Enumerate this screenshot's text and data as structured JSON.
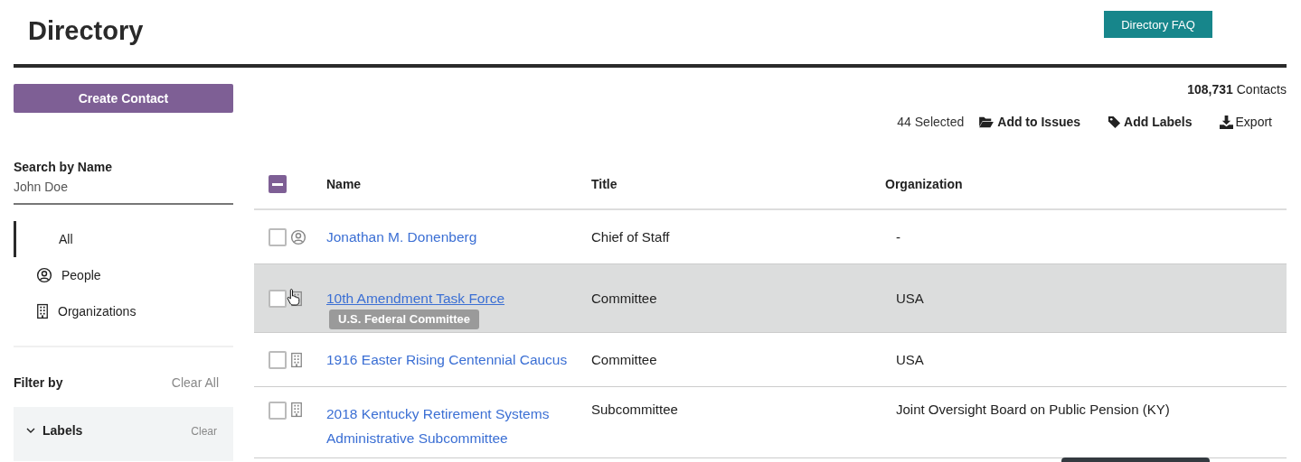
{
  "page": {
    "title": "Directory",
    "faq_button": "Directory FAQ"
  },
  "sidebar": {
    "create_button": "Create Contact",
    "search": {
      "label": "Search by Name",
      "placeholder": "John Doe"
    },
    "nav": [
      {
        "label": "All",
        "kind": "all",
        "selected": true
      },
      {
        "label": "People",
        "kind": "person",
        "selected": false
      },
      {
        "label": "Organizations",
        "kind": "organization",
        "selected": false
      }
    ],
    "filter": {
      "title": "Filter by",
      "clear_all": "Clear All",
      "groups": [
        {
          "label": "Labels",
          "clear": "Clear",
          "expanded": true
        }
      ]
    }
  },
  "summary": {
    "count": "108,731",
    "unit": "Contacts"
  },
  "toolbar": {
    "selected_count": "44 Selected",
    "actions": [
      {
        "label": "Add to Issues",
        "kind": "folder",
        "bold": true
      },
      {
        "label": "Add Labels",
        "kind": "tag",
        "bold": true
      },
      {
        "label": "Export",
        "kind": "download",
        "bold": false
      }
    ]
  },
  "table": {
    "select_all": {
      "indeterminate": true
    },
    "columns": [
      "Name",
      "Title",
      "Organization"
    ],
    "rows": [
      {
        "kind": "person",
        "checked": false,
        "hovered": false,
        "name": "Jonathan M. Donenberg",
        "title": "Chief of Staff",
        "organization": "-"
      },
      {
        "kind": "organization",
        "checked": false,
        "hovered": true,
        "name": "10th Amendment Task Force",
        "title": "Committee",
        "organization": "USA",
        "tooltip": "U.S. Federal Committee"
      },
      {
        "kind": "organization",
        "checked": false,
        "hovered": false,
        "name": "1916 Easter Rising Centennial Caucus",
        "title": "Committee",
        "organization": "USA"
      },
      {
        "kind": "organization",
        "checked": false,
        "hovered": false,
        "name": "2018 Kentucky Retirement Systems Administrative Subcommittee",
        "title": "Subcommittee",
        "organization": "Joint Oversight Board on Public Pension (KY)"
      }
    ]
  }
}
